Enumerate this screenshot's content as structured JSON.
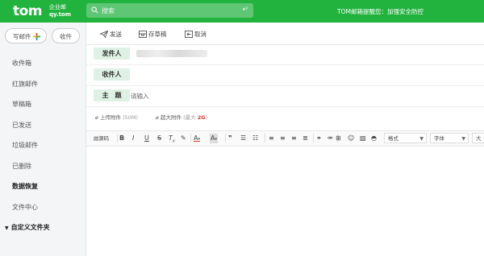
{
  "header": {
    "logo_main": "tom",
    "logo_sub1": "企业邮",
    "logo_sub2": "qy.tom",
    "search_placeholder": "搜索",
    "notice": "TOM邮箱提醒您：加强安全防控"
  },
  "sidebar": {
    "write_label": "写邮件",
    "receive_label": "收件",
    "items": [
      {
        "label": "收件箱"
      },
      {
        "label": "红旗邮件"
      },
      {
        "label": "草稿箱"
      },
      {
        "label": "已发送"
      },
      {
        "label": "垃圾邮件"
      },
      {
        "label": "已删除"
      },
      {
        "label": "数据恢复"
      },
      {
        "label": "文件中心"
      },
      {
        "label": "自定义文件夹"
      }
    ]
  },
  "toolbar": {
    "send": "发送",
    "save_draft": "存草稿",
    "cancel": "取消"
  },
  "compose": {
    "sender_label": "发件人",
    "recipient_label": "收件人",
    "subject_label": "主　题",
    "subject_placeholder": "请输入",
    "upload_attachment": "上传附件",
    "upload_hint": "(50M)",
    "big_attachment": "超大附件",
    "big_hint_pre": "(最大",
    "big_hint_size": "2G",
    "big_hint_post": ")"
  },
  "editor": {
    "source_label": "源码",
    "format_select": "格式",
    "font_select": "字体",
    "size_select": "大小"
  },
  "colors": {
    "brand": "#22b33f",
    "label_bg": "#dff1e4"
  }
}
